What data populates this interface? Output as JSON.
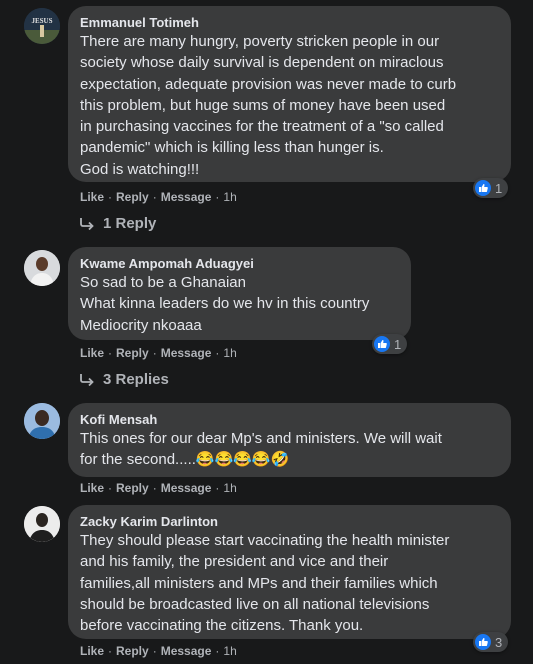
{
  "comments": [
    {
      "author": "Emmanuel Totimeh",
      "text": "There are many hungry, poverty stricken people in our\nsociety whose daily survival is dependent on miraclous\nexpectation, adequate provision was never made to curb\nthis problem, but huge sums of money have been used\nin purchasing vaccines for the treatment of a \"so called\npandemic\" which is killing less than hunger is.\nGod is watching!!!",
      "like": "Like",
      "reply": "Reply",
      "message": "Message",
      "time": "1h",
      "reaction_count": "1",
      "replies_label": "1 Reply"
    },
    {
      "author": "Kwame Ampomah Aduagyei",
      "text": "So sad to be a Ghanaian\nWhat kinna leaders do we hv in this country\nMediocrity nkoaaa",
      "like": "Like",
      "reply": "Reply",
      "message": "Message",
      "time": "1h",
      "reaction_count": "1",
      "replies_label": "3 Replies"
    },
    {
      "author": "Kofi Mensah",
      "text": "This ones for our dear Mp's and ministers. We will wait\nfor the second.....😂😂😂😂🤣",
      "like": "Like",
      "reply": "Reply",
      "message": "Message",
      "time": "1h"
    },
    {
      "author": "Zacky Karim Darlinton",
      "text": "They should please start vaccinating the health minister\nand his family, the president and vice and their\nfamilies,all ministers and MPs and their families which\nshould be broadcasted live on all national televisions\nbefore vaccinating the citizens. Thank you.",
      "like": "Like",
      "reply": "Reply",
      "message": "Message",
      "time": "1h",
      "reaction_count": "3"
    }
  ],
  "avatar_1_text": "JESUS",
  "colors": {
    "background": "#18191a",
    "bubble": "#3a3b3c",
    "like_blue": "#1877f2",
    "secondary_text": "#b0b3b8"
  }
}
